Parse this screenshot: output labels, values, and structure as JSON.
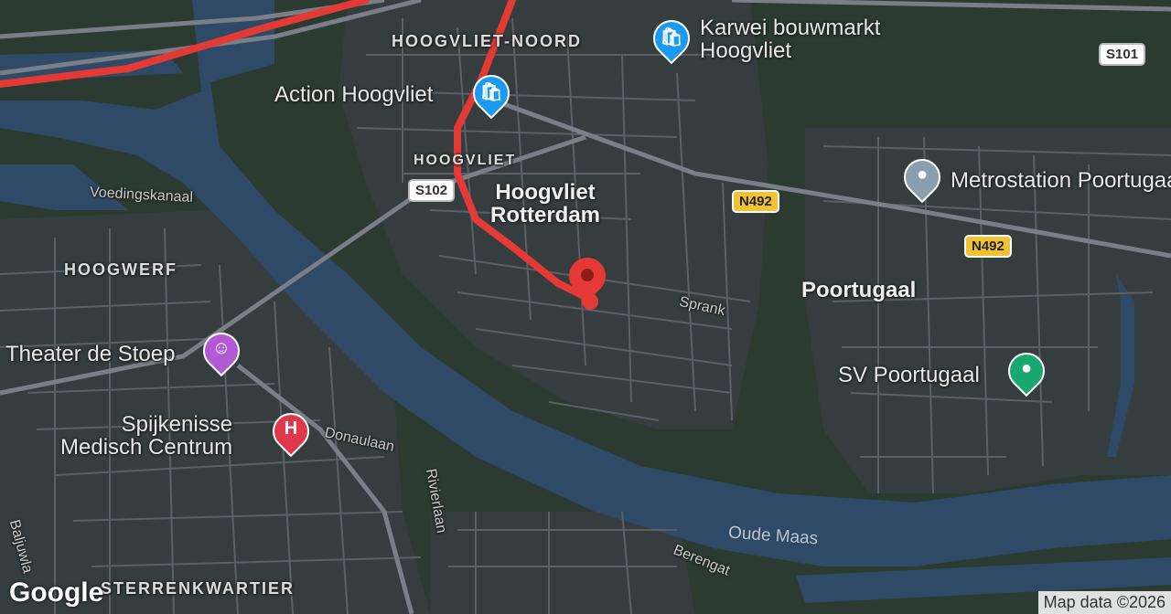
{
  "map": {
    "districts": [
      {
        "id": "hoogvliet-noord",
        "text": "HOOGVLIET-NOORD"
      },
      {
        "id": "hoogvliet",
        "text": "HOOGVLIET"
      },
      {
        "id": "hoogwerf",
        "text": "HOOGWERF"
      },
      {
        "id": "sterrenkwartier",
        "text": "STERRENKWARTIER"
      }
    ],
    "places": [
      {
        "id": "hoogvliet-rotterdam",
        "line1": "Hoogvliet",
        "line2": "Rotterdam"
      },
      {
        "id": "poortugaal",
        "text": "Poortugaal"
      }
    ],
    "pois": [
      {
        "id": "karwei",
        "line1": "Karwei bouwmarkt",
        "line2": "Hoogvliet",
        "icon": "shopping-bag-icon",
        "color": "#1a9af0"
      },
      {
        "id": "action",
        "text": "Action Hoogvliet",
        "icon": "shopping-bag-icon",
        "color": "#1a9af0"
      },
      {
        "id": "metrostation",
        "text": "Metrostation Poortugaal",
        "icon": "transit-icon",
        "color": "#8a9eae"
      },
      {
        "id": "sv-poortugaal",
        "text": "SV Poortugaal",
        "icon": "park-icon",
        "color": "#18a870"
      },
      {
        "id": "theater",
        "text": "Theater de Stoep",
        "icon": "theater-masks-icon",
        "color": "#b05ad6"
      },
      {
        "id": "spijkenisse",
        "line1": "Spijkenisse",
        "line2": "Medisch Centrum",
        "icon": "hospital-icon",
        "glyph": "H",
        "color": "#e0384a"
      }
    ],
    "streets": [
      {
        "id": "voedingskanaal",
        "text": "Voedingskanaal"
      },
      {
        "id": "sprank",
        "text": "Sprank"
      },
      {
        "id": "donaulaan",
        "text": "Donaulaan"
      },
      {
        "id": "rivierlaan",
        "text": "Rivierlaan"
      },
      {
        "id": "baljuwlaan",
        "text": "Baljuwla"
      },
      {
        "id": "berengat",
        "text": "Berengat"
      }
    ],
    "water": [
      {
        "id": "oude-maas",
        "text": "Oude Maas"
      }
    ],
    "shields": [
      {
        "id": "s101",
        "text": "S101",
        "type": "white"
      },
      {
        "id": "s102",
        "text": "S102",
        "type": "white"
      },
      {
        "id": "n492a",
        "text": "N492",
        "type": "yellow"
      },
      {
        "id": "n492b",
        "text": "N492",
        "type": "yellow"
      }
    ],
    "route_color": "#e53935",
    "destination_marker_color": "#e53935"
  },
  "branding": {
    "logo": "Google",
    "attribution": "Map data ©2026"
  }
}
